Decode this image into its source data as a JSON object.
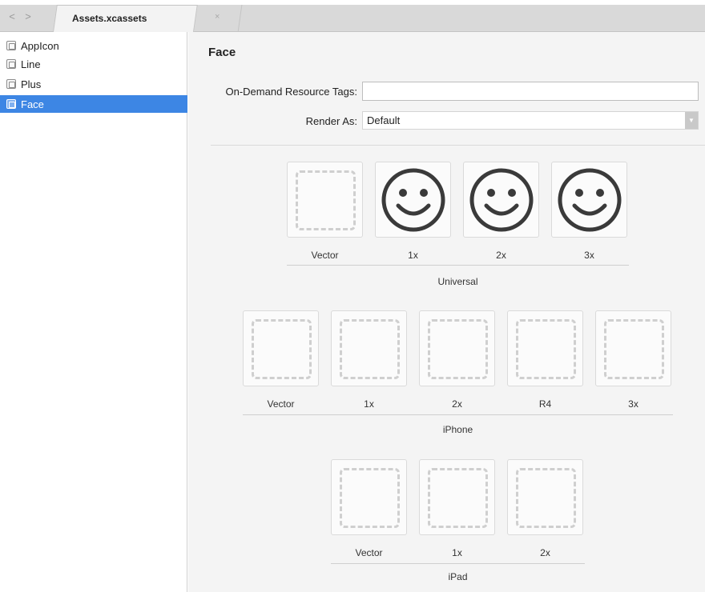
{
  "tabbar": {
    "back": "<",
    "forward": ">",
    "active_tab": "Assets.xcassets",
    "close": "×"
  },
  "sidebar": {
    "items": [
      {
        "label": "AppIcon",
        "icon": "appicon-set-icon",
        "selected": false
      },
      {
        "label": "Line",
        "icon": "image-set-icon",
        "selected": false
      },
      {
        "label": "Plus",
        "icon": "image-set-icon",
        "selected": false
      },
      {
        "label": "Face",
        "icon": "image-set-icon",
        "selected": true
      }
    ]
  },
  "detail": {
    "title": "Face",
    "tags_label": "On-Demand Resource Tags:",
    "tags_value": "",
    "render_label": "Render As:",
    "render_value": "Default"
  },
  "groups": [
    {
      "name": "Universal",
      "slots": [
        {
          "label": "Vector",
          "filled": false
        },
        {
          "label": "1x",
          "filled": true
        },
        {
          "label": "2x",
          "filled": true
        },
        {
          "label": "3x",
          "filled": true
        }
      ]
    },
    {
      "name": "iPhone",
      "slots": [
        {
          "label": "Vector",
          "filled": false
        },
        {
          "label": "1x",
          "filled": false
        },
        {
          "label": "2x",
          "filled": false
        },
        {
          "label": "R4",
          "filled": false
        },
        {
          "label": "3x",
          "filled": false
        }
      ]
    },
    {
      "name": "iPad",
      "slots": [
        {
          "label": "Vector",
          "filled": false
        },
        {
          "label": "1x",
          "filled": false
        },
        {
          "label": "2x",
          "filled": false
        }
      ]
    }
  ],
  "colors": {
    "selection": "#3d86e4",
    "smiley": "#3a3a3a"
  }
}
